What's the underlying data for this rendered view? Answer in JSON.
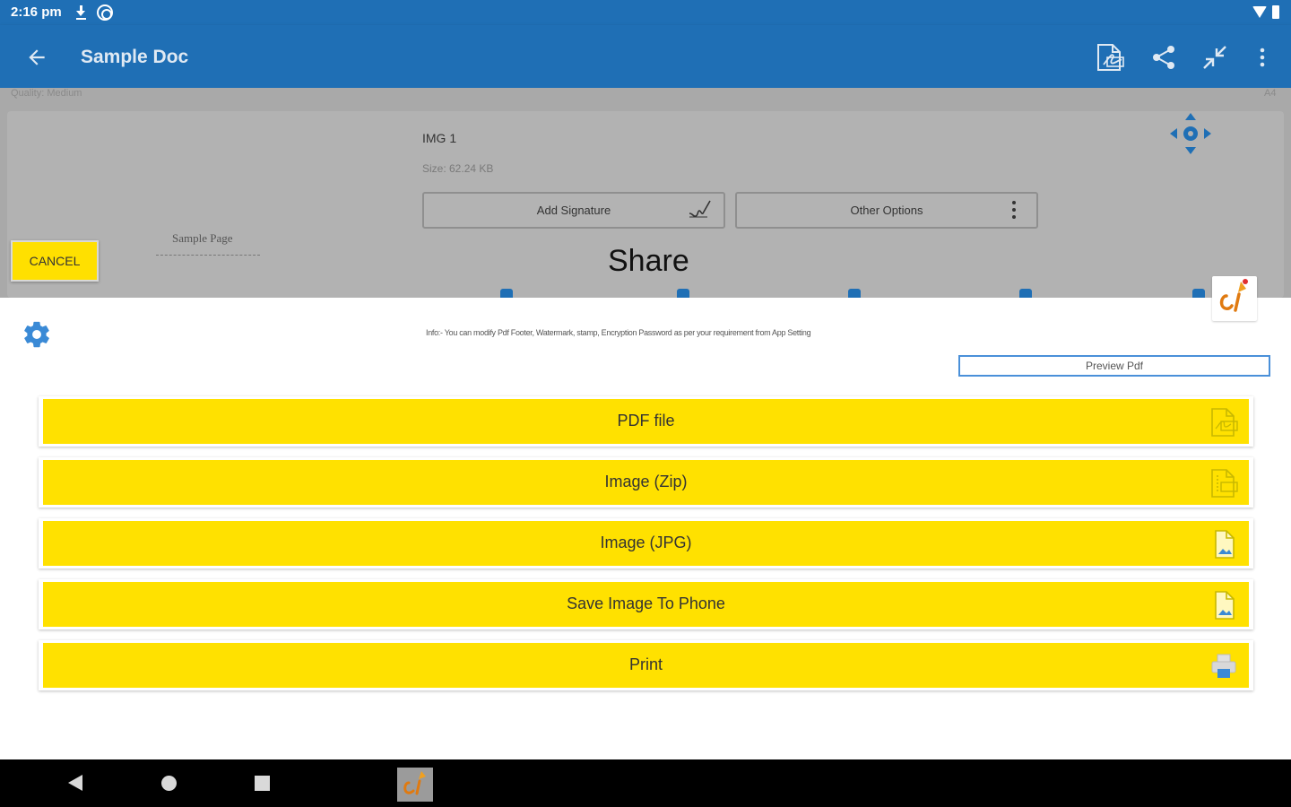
{
  "status_bar": {
    "time": "2:16 pm"
  },
  "app_bar": {
    "title": "Sample Doc"
  },
  "background": {
    "quality": "Quality: Medium",
    "quality_right": "A4",
    "image_title": "IMG 1",
    "image_size": "Size: 62.24 KB",
    "add_signature": "Add Signature",
    "other_options": "Other Options",
    "sample_page": "Sample Page",
    "cancel": "CANCEL"
  },
  "sheet": {
    "title": "Share",
    "info": "Info:- You can modify Pdf Footer, Watermark, stamp, Encryption Password as per your requirement from App Setting",
    "preview_label": "Preview Pdf",
    "options": [
      {
        "label": "PDF file",
        "icon": "pdf-file-icon"
      },
      {
        "label": "Image (Zip)",
        "icon": "zip-file-icon"
      },
      {
        "label": "Image (JPG)",
        "icon": "image-file-icon"
      },
      {
        "label": "Save Image To Phone",
        "icon": "image-file-icon"
      },
      {
        "label": "Print",
        "icon": "printer-icon"
      }
    ]
  },
  "colors": {
    "primary": "#1f6fb5",
    "accent_yellow": "#ffe100",
    "status_bar": "#1f6fb5"
  }
}
